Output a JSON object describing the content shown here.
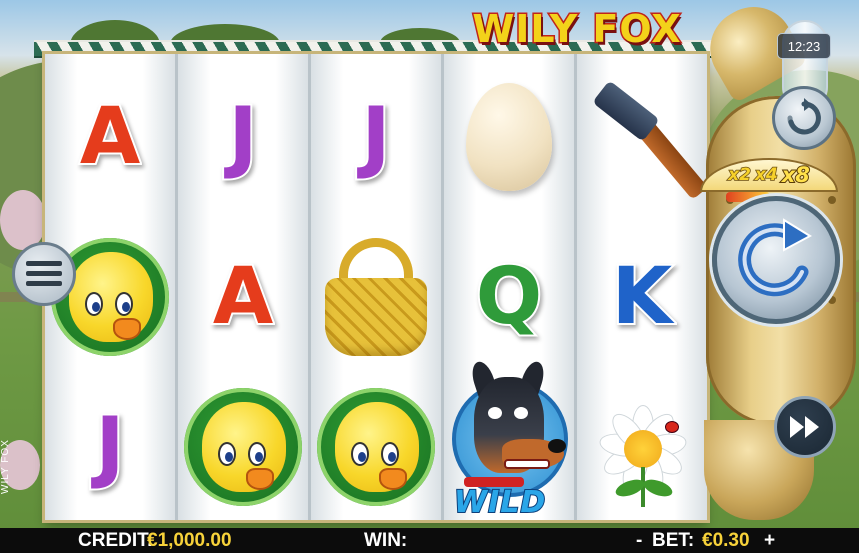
{
  "game": {
    "logo_text": "WILY FOX",
    "side_label": "WILY FOX"
  },
  "clock": {
    "time": "12:23"
  },
  "reels": [
    [
      {
        "symbol": "A",
        "kind": "letter",
        "color": "#e53c1c"
      },
      {
        "symbol": "chick",
        "kind": "picture"
      },
      {
        "symbol": "J",
        "kind": "letter",
        "color": "#a23fc7"
      }
    ],
    [
      {
        "symbol": "J",
        "kind": "letter",
        "color": "#a23fc7"
      },
      {
        "symbol": "A",
        "kind": "letter",
        "color": "#e53c1c"
      },
      {
        "symbol": "chick",
        "kind": "picture"
      }
    ],
    [
      {
        "symbol": "J",
        "kind": "letter",
        "color": "#a23fc7"
      },
      {
        "symbol": "basket",
        "kind": "picture"
      },
      {
        "symbol": "chick",
        "kind": "picture"
      }
    ],
    [
      {
        "symbol": "egg",
        "kind": "picture"
      },
      {
        "symbol": "Q",
        "kind": "letter",
        "color": "#2f9b3a"
      },
      {
        "symbol": "wild-dog",
        "kind": "picture",
        "label": "WILD"
      }
    ],
    [
      {
        "symbol": "hammer",
        "kind": "picture"
      },
      {
        "symbol": "K",
        "kind": "letter",
        "color": "#1f63c9"
      },
      {
        "symbol": "daisy",
        "kind": "picture"
      }
    ]
  ],
  "multipliers": {
    "values": [
      "x2",
      "x4",
      "x8"
    ],
    "active": "x8"
  },
  "buttons": {
    "replay_icon": "replay-icon",
    "spin_icon": "spin-icon",
    "turbo_icon": "fast-forward-icon",
    "menu_icon": "menu-icon"
  },
  "status_bar": {
    "credit_label": "CREDIT:",
    "credit_value": "€1,000.00",
    "win_label": "WIN:",
    "win_value": "",
    "bet_minus": "-",
    "bet_label": "BET:",
    "bet_value": "€0.30",
    "bet_plus": "+"
  },
  "colors": {
    "reel_frame": "#c7b57a",
    "value_text": "#f7d23a",
    "status_bar_bg": "#0c0c0c",
    "logo_fill": "#f3d21a",
    "logo_outline": "#c0241a"
  }
}
